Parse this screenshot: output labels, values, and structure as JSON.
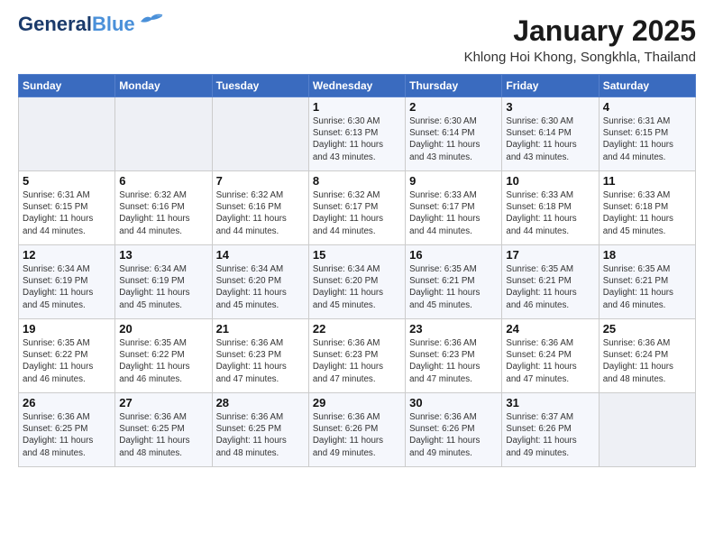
{
  "header": {
    "logo_line1": "General",
    "logo_line2": "Blue",
    "month": "January 2025",
    "location": "Khlong Hoi Khong, Songkhla, Thailand"
  },
  "days_of_week": [
    "Sunday",
    "Monday",
    "Tuesday",
    "Wednesday",
    "Thursday",
    "Friday",
    "Saturday"
  ],
  "weeks": [
    [
      {
        "day": "",
        "info": ""
      },
      {
        "day": "",
        "info": ""
      },
      {
        "day": "",
        "info": ""
      },
      {
        "day": "1",
        "info": "Sunrise: 6:30 AM\nSunset: 6:13 PM\nDaylight: 11 hours\nand 43 minutes."
      },
      {
        "day": "2",
        "info": "Sunrise: 6:30 AM\nSunset: 6:14 PM\nDaylight: 11 hours\nand 43 minutes."
      },
      {
        "day": "3",
        "info": "Sunrise: 6:30 AM\nSunset: 6:14 PM\nDaylight: 11 hours\nand 43 minutes."
      },
      {
        "day": "4",
        "info": "Sunrise: 6:31 AM\nSunset: 6:15 PM\nDaylight: 11 hours\nand 44 minutes."
      }
    ],
    [
      {
        "day": "5",
        "info": "Sunrise: 6:31 AM\nSunset: 6:15 PM\nDaylight: 11 hours\nand 44 minutes."
      },
      {
        "day": "6",
        "info": "Sunrise: 6:32 AM\nSunset: 6:16 PM\nDaylight: 11 hours\nand 44 minutes."
      },
      {
        "day": "7",
        "info": "Sunrise: 6:32 AM\nSunset: 6:16 PM\nDaylight: 11 hours\nand 44 minutes."
      },
      {
        "day": "8",
        "info": "Sunrise: 6:32 AM\nSunset: 6:17 PM\nDaylight: 11 hours\nand 44 minutes."
      },
      {
        "day": "9",
        "info": "Sunrise: 6:33 AM\nSunset: 6:17 PM\nDaylight: 11 hours\nand 44 minutes."
      },
      {
        "day": "10",
        "info": "Sunrise: 6:33 AM\nSunset: 6:18 PM\nDaylight: 11 hours\nand 44 minutes."
      },
      {
        "day": "11",
        "info": "Sunrise: 6:33 AM\nSunset: 6:18 PM\nDaylight: 11 hours\nand 45 minutes."
      }
    ],
    [
      {
        "day": "12",
        "info": "Sunrise: 6:34 AM\nSunset: 6:19 PM\nDaylight: 11 hours\nand 45 minutes."
      },
      {
        "day": "13",
        "info": "Sunrise: 6:34 AM\nSunset: 6:19 PM\nDaylight: 11 hours\nand 45 minutes."
      },
      {
        "day": "14",
        "info": "Sunrise: 6:34 AM\nSunset: 6:20 PM\nDaylight: 11 hours\nand 45 minutes."
      },
      {
        "day": "15",
        "info": "Sunrise: 6:34 AM\nSunset: 6:20 PM\nDaylight: 11 hours\nand 45 minutes."
      },
      {
        "day": "16",
        "info": "Sunrise: 6:35 AM\nSunset: 6:21 PM\nDaylight: 11 hours\nand 45 minutes."
      },
      {
        "day": "17",
        "info": "Sunrise: 6:35 AM\nSunset: 6:21 PM\nDaylight: 11 hours\nand 46 minutes."
      },
      {
        "day": "18",
        "info": "Sunrise: 6:35 AM\nSunset: 6:21 PM\nDaylight: 11 hours\nand 46 minutes."
      }
    ],
    [
      {
        "day": "19",
        "info": "Sunrise: 6:35 AM\nSunset: 6:22 PM\nDaylight: 11 hours\nand 46 minutes."
      },
      {
        "day": "20",
        "info": "Sunrise: 6:35 AM\nSunset: 6:22 PM\nDaylight: 11 hours\nand 46 minutes."
      },
      {
        "day": "21",
        "info": "Sunrise: 6:36 AM\nSunset: 6:23 PM\nDaylight: 11 hours\nand 47 minutes."
      },
      {
        "day": "22",
        "info": "Sunrise: 6:36 AM\nSunset: 6:23 PM\nDaylight: 11 hours\nand 47 minutes."
      },
      {
        "day": "23",
        "info": "Sunrise: 6:36 AM\nSunset: 6:23 PM\nDaylight: 11 hours\nand 47 minutes."
      },
      {
        "day": "24",
        "info": "Sunrise: 6:36 AM\nSunset: 6:24 PM\nDaylight: 11 hours\nand 47 minutes."
      },
      {
        "day": "25",
        "info": "Sunrise: 6:36 AM\nSunset: 6:24 PM\nDaylight: 11 hours\nand 48 minutes."
      }
    ],
    [
      {
        "day": "26",
        "info": "Sunrise: 6:36 AM\nSunset: 6:25 PM\nDaylight: 11 hours\nand 48 minutes."
      },
      {
        "day": "27",
        "info": "Sunrise: 6:36 AM\nSunset: 6:25 PM\nDaylight: 11 hours\nand 48 minutes."
      },
      {
        "day": "28",
        "info": "Sunrise: 6:36 AM\nSunset: 6:25 PM\nDaylight: 11 hours\nand 48 minutes."
      },
      {
        "day": "29",
        "info": "Sunrise: 6:36 AM\nSunset: 6:26 PM\nDaylight: 11 hours\nand 49 minutes."
      },
      {
        "day": "30",
        "info": "Sunrise: 6:36 AM\nSunset: 6:26 PM\nDaylight: 11 hours\nand 49 minutes."
      },
      {
        "day": "31",
        "info": "Sunrise: 6:37 AM\nSunset: 6:26 PM\nDaylight: 11 hours\nand 49 minutes."
      },
      {
        "day": "",
        "info": ""
      }
    ]
  ]
}
